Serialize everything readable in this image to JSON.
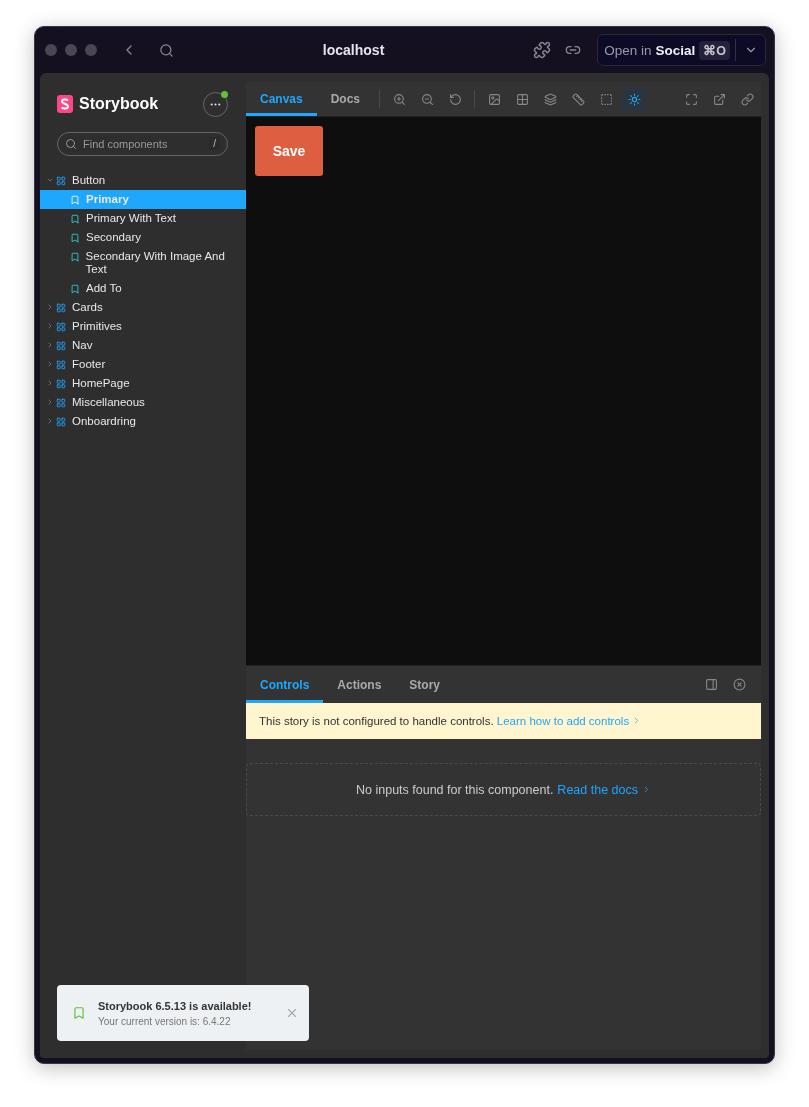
{
  "window": {
    "title": "localhost",
    "open_in": {
      "prefix": "Open in",
      "app": "Social",
      "shortcut": "⌘O"
    }
  },
  "sidebar": {
    "brand": "Storybook",
    "search": {
      "placeholder": "Find components",
      "shortcut": "/"
    },
    "update_dot": true,
    "tree": [
      {
        "label": "Button",
        "kind": "component",
        "expanded": true,
        "selected": false,
        "children": [
          {
            "label": "Primary",
            "kind": "story",
            "selected": true
          },
          {
            "label": "Primary With Text",
            "kind": "story",
            "selected": false
          },
          {
            "label": "Secondary",
            "kind": "story",
            "selected": false
          },
          {
            "label": "Secondary With Image And Text",
            "kind": "story",
            "selected": false
          },
          {
            "label": "Add To",
            "kind": "story",
            "selected": false
          }
        ]
      },
      {
        "label": "Cards",
        "kind": "component",
        "expanded": false,
        "selected": false
      },
      {
        "label": "Primitives",
        "kind": "component",
        "expanded": false,
        "selected": false
      },
      {
        "label": "Nav",
        "kind": "component",
        "expanded": false,
        "selected": false
      },
      {
        "label": "Footer",
        "kind": "component",
        "expanded": false,
        "selected": false
      },
      {
        "label": "HomePage",
        "kind": "component",
        "expanded": false,
        "selected": false
      },
      {
        "label": "Miscellaneous",
        "kind": "component",
        "expanded": false,
        "selected": false
      },
      {
        "label": "Onboardring",
        "kind": "component",
        "expanded": false,
        "selected": false
      }
    ]
  },
  "toolbar": {
    "tabs": [
      {
        "label": "Canvas",
        "selected": true
      },
      {
        "label": "Docs",
        "selected": false
      }
    ],
    "zoom_tools": [
      {
        "selected": false
      },
      {
        "selected": false
      },
      {
        "selected": false
      }
    ],
    "view_tools": [
      {
        "selected": false
      },
      {
        "selected": false
      },
      {
        "selected": false
      },
      {
        "selected": false
      },
      {
        "selected": false
      },
      {
        "selected": true
      }
    ],
    "right_tools": [
      {
        "selected": false
      },
      {
        "selected": false
      },
      {
        "selected": false
      }
    ]
  },
  "canvas": {
    "button": "Save"
  },
  "addons": {
    "tabs": [
      {
        "label": "Controls",
        "selected": true
      },
      {
        "label": "Actions",
        "selected": false
      },
      {
        "label": "Story",
        "selected": false
      }
    ],
    "notice": {
      "text": "This story is not configured to handle controls.",
      "link": "Learn how to add controls"
    },
    "empty": {
      "text": "No inputs found for this component.",
      "link": "Read the docs"
    }
  },
  "toast": {
    "title": "Storybook 6.5.13 is available!",
    "subtitle": "Your current version is: 6.4.22"
  }
}
